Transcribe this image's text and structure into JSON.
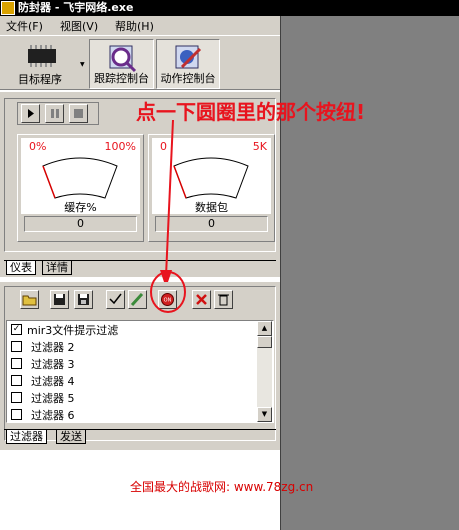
{
  "window": {
    "title": "防封器 - 飞宇网络.exe"
  },
  "menu": [
    {
      "label": "文件(F)"
    },
    {
      "label": "视图(V)"
    },
    {
      "label": "帮助(H)"
    }
  ],
  "toolbar": {
    "target": "目标程序",
    "trace": "跟踪控制台",
    "action": "动作控制台"
  },
  "annotation": "点一下圆圈里的那个按纽!",
  "gauges": [
    {
      "min": "0%",
      "max": "100%",
      "label": "缓存%",
      "value": "0",
      "level": 0
    },
    {
      "min": "0",
      "max": "5K",
      "label": "数据包",
      "value": "0",
      "level": 0
    }
  ],
  "tabs_top": [
    {
      "label": "仪表"
    },
    {
      "label": "详情"
    }
  ],
  "filters": [
    {
      "label": "mir3文件提示过滤",
      "checked": true
    },
    {
      "label": "过滤器 2",
      "checked": false
    },
    {
      "label": "过滤器 3",
      "checked": false
    },
    {
      "label": "过滤器 4",
      "checked": false
    },
    {
      "label": "过滤器 5",
      "checked": false
    },
    {
      "label": "过滤器 6",
      "checked": false
    }
  ],
  "tabs_bottom": [
    {
      "label": "过滤器"
    },
    {
      "label": "发送"
    }
  ],
  "footer": "全国最大的战歌网: www.78zg.cn",
  "colors": {
    "annotation": "#e8141e",
    "gauge_needle": "#d80000",
    "gauge_scale": "#e8141e"
  },
  "icons": [
    "play-icon",
    "pause-icon",
    "stop-icon",
    "open-folder-icon",
    "save-icon",
    "save-all-icon",
    "check-edit-icon",
    "pencil-icon",
    "on-button-icon",
    "delete-x-icon",
    "trash-icon"
  ]
}
